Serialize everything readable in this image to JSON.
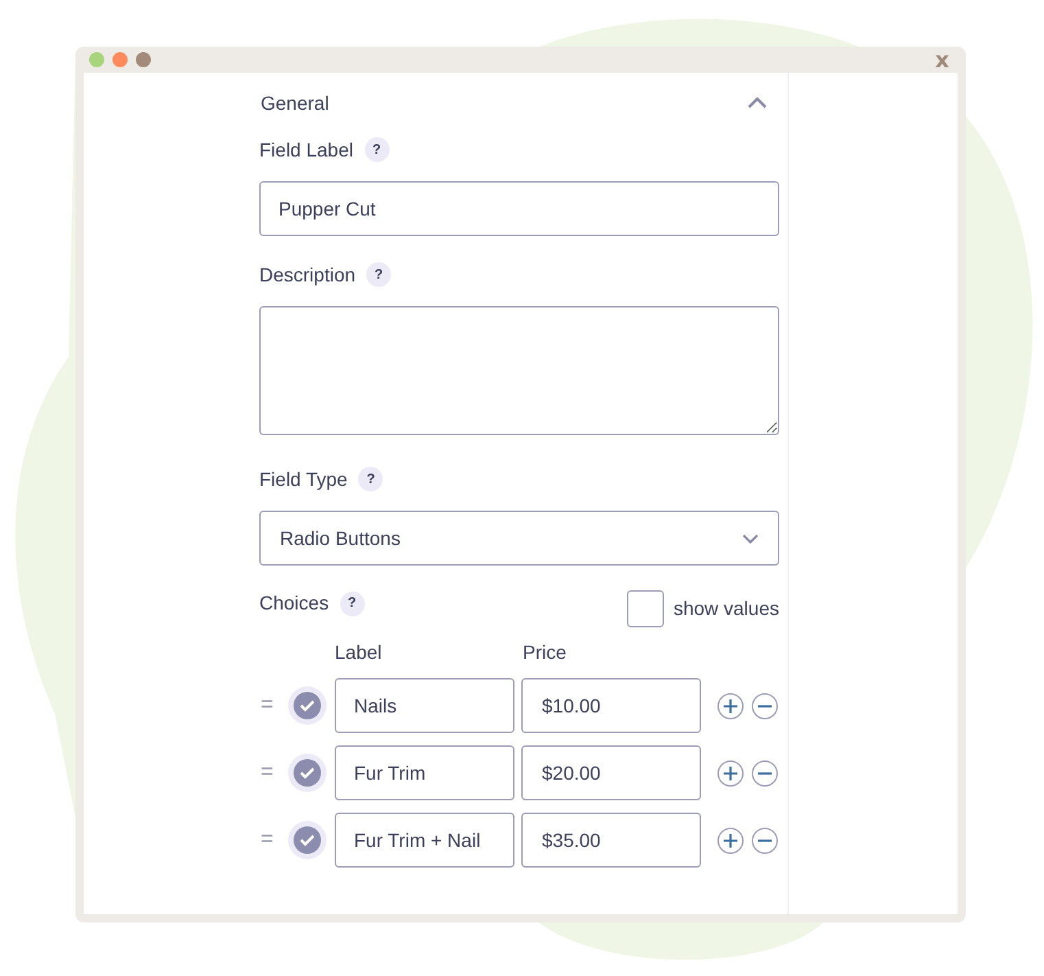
{
  "window": {
    "close": "x"
  },
  "section": {
    "title": "General",
    "expanded": true
  },
  "field_label": {
    "label": "Field Label",
    "help": "?",
    "value": "Pupper Cut"
  },
  "description": {
    "label": "Description",
    "help": "?"
  },
  "field_type": {
    "label": "Field Type",
    "help": "?",
    "value": "Radio Buttons"
  },
  "choices": {
    "label": "Choices",
    "help": "?",
    "show_values": {
      "label": "show values",
      "checked": false
    },
    "columns": [
      "Label",
      "Price"
    ],
    "rows": [
      {
        "handle": "=",
        "checked": true,
        "label": "Nails",
        "price": "$10.00"
      },
      {
        "handle": "=",
        "checked": true,
        "label": "Fur Trim",
        "price": "$20.00"
      },
      {
        "handle": "=",
        "checked": true,
        "label": "Fur Trim + Nail",
        "price": "$35.00"
      }
    ]
  }
}
